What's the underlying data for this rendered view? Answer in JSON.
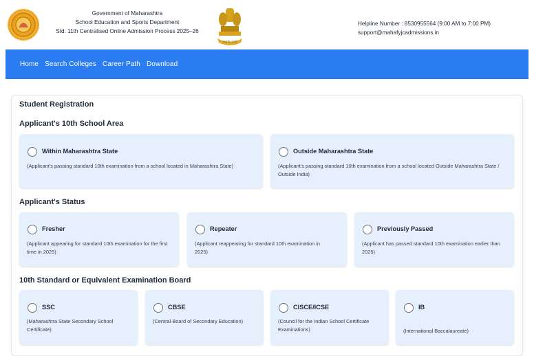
{
  "header": {
    "govt": "Government of Maharashtra",
    "dept": "School Education and Sports Department",
    "process": "Std. 11th Centralised Online Admission Process 2025–26",
    "helpline": "Helpline Number : 8530955564 (9:00 AM to 7:00 PM)",
    "email": "support@mahafyjcadmissions.in",
    "emblem_motto": "सत्यमेव जयते"
  },
  "nav": {
    "home": "Home",
    "search": "Search Colleges",
    "career": "Career Path",
    "download": "Download"
  },
  "form": {
    "title": "Student Registration",
    "area_title": "Applicant's 10th School Area",
    "status_title": "Applicant's Status",
    "board_title": "10th Standard or Equivalent Examination Board"
  },
  "area": {
    "within_label": "Within Maharashtra State",
    "within_desc": "(Applicant's passing standard 10th examination from a school located in Maharashtra State)",
    "outside_label": "Outside Maharashtra State",
    "outside_desc": "(Applicant's passing standard 10th examination from a school located Outside Maharashtra State / Outside India)"
  },
  "status": {
    "fresher_label": "Fresher",
    "fresher_desc": "(Applicant appearing for standard 10th examination for the first time in 2025)",
    "repeater_label": "Repeater",
    "repeater_desc": "(Applicant reappearing for standard 10th examination in 2025)",
    "passed_label": "Previously Passed",
    "passed_desc": "(Applicant has passed standard 10th examination earlier than 2025)"
  },
  "board": {
    "ssc_label": "SSC",
    "ssc_desc": "(Maharashtra State Secondary School Certificate)",
    "cbse_label": "CBSE",
    "cbse_desc": "(Central Board of Secondary Education)",
    "cisce_label": "CISCE/ICSE",
    "cisce_desc": "(Council for the Indian School Certificate Examinations)",
    "ib_label": "IB",
    "ib_desc": "(International Baccalaureate)"
  },
  "colors": {
    "nav_bg": "#2b7cf0",
    "card_bg": "#e6f0fc"
  }
}
